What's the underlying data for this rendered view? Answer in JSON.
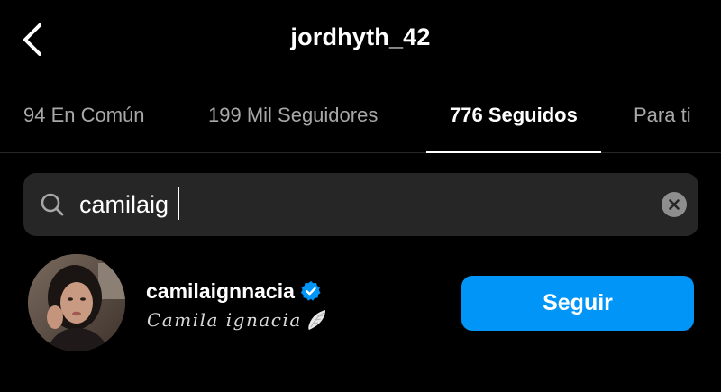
{
  "header": {
    "title": "jordhyth_42",
    "back_icon": "chevron-left-icon"
  },
  "tabs": [
    {
      "label": "94 En Común",
      "active": false
    },
    {
      "label": "199 Mil Seguidores",
      "active": false
    },
    {
      "label": "776 Seguidos",
      "active": true
    },
    {
      "label": "Para ti",
      "active": false
    }
  ],
  "search": {
    "value": "camilaig",
    "icon": "search-icon",
    "clear_icon": "clear-icon"
  },
  "result": {
    "username": "camilaignnacia",
    "verified": true,
    "full_name": "Camila ignacia",
    "follow_label": "Seguir"
  },
  "colors": {
    "background": "#000000",
    "search_bg": "#262626",
    "muted_text": "#a8a8a8",
    "accent": "#0095f6",
    "verified": "#0095f6"
  }
}
